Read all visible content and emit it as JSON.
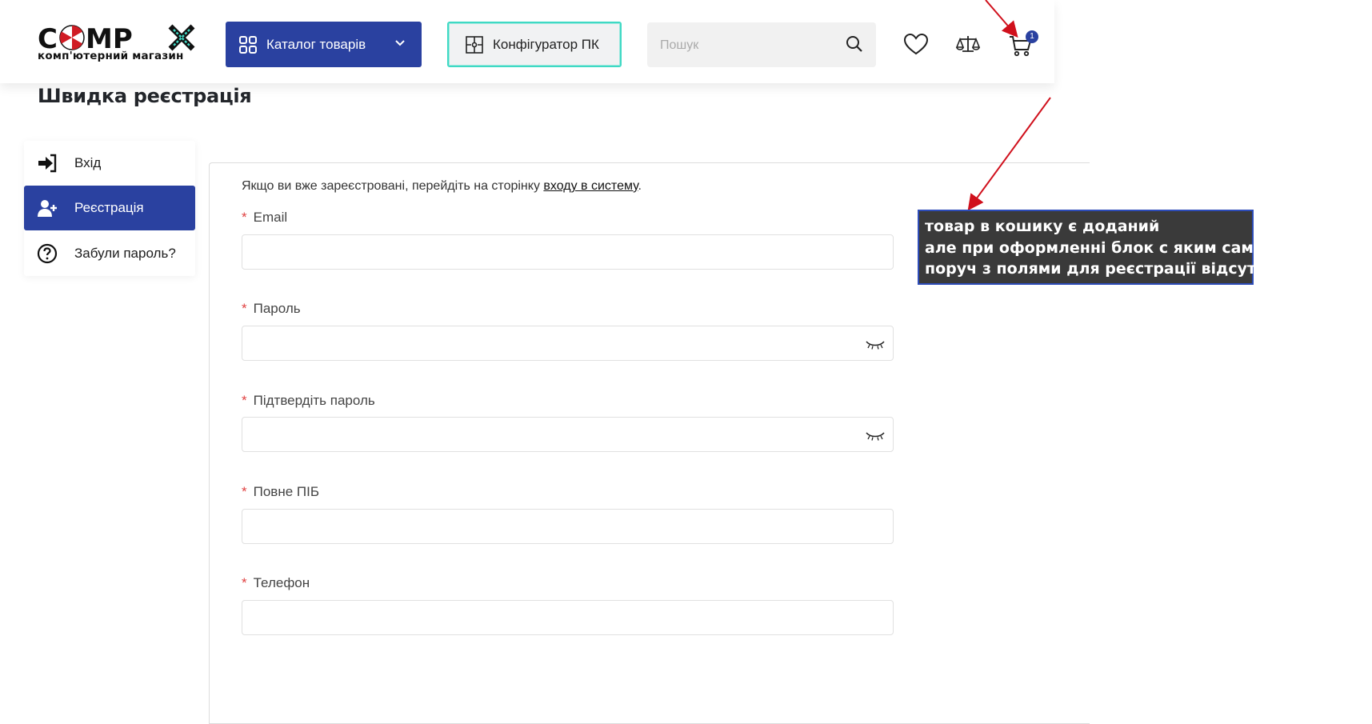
{
  "header": {
    "logo_text": "C MP X",
    "logo_subtitle": "комп'ютерний магазин",
    "catalog_label": "Каталог товарів",
    "configurator_label": "Конфігуратор ПК",
    "search_placeholder": "Пошук",
    "cart_count": "1"
  },
  "page": {
    "title": "Швидка реєстрація"
  },
  "sidebar": {
    "items": [
      {
        "label": "Вхід",
        "icon": "login-icon"
      },
      {
        "label": "Реєстрація",
        "icon": "add-user-icon"
      },
      {
        "label": "Забули пароль?",
        "icon": "question-icon"
      }
    ]
  },
  "form": {
    "intro_text": "Якщо ви вже зареєстровані, перейдіть на сторінку ",
    "intro_link": "входу в систему",
    "intro_end": ".",
    "required_mark": "*",
    "fields": [
      {
        "label": "Email",
        "value": ""
      },
      {
        "label": "Пароль",
        "value": ""
      },
      {
        "label": "Підтвердіть пароль",
        "value": ""
      },
      {
        "label": "Повне ПІБ",
        "value": ""
      },
      {
        "label": "Телефон",
        "value": ""
      }
    ]
  },
  "annotation": {
    "lines": [
      "товар в кошику є доданий",
      "але при оформленні блок с яким саме",
      "поруч з полями для реєстрації відсутній"
    ]
  },
  "colors": {
    "brand_blue": "#2a41a0",
    "accent_teal": "#3fd9c4",
    "required_red": "#e04040",
    "annotation_arrow": "#d0101c"
  }
}
